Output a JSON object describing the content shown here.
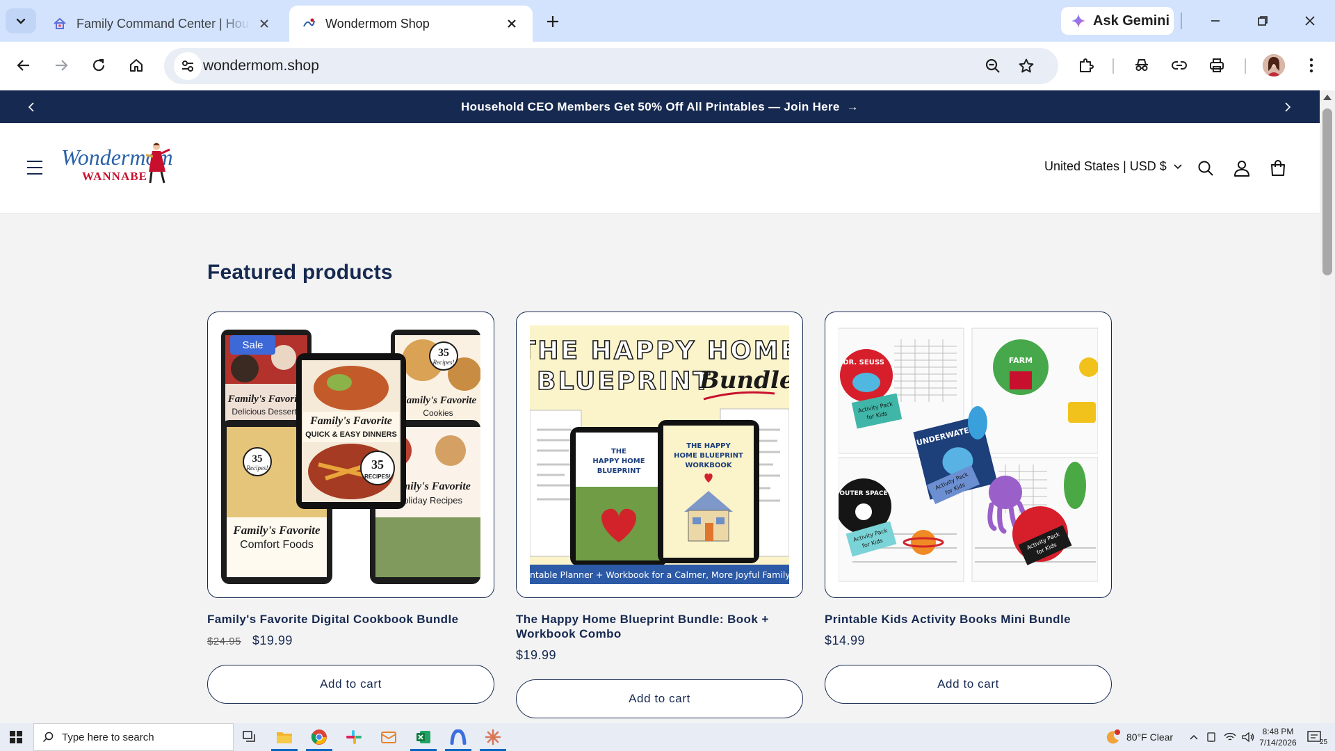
{
  "browser": {
    "tabs": [
      {
        "title": "Family Command Center | Hous",
        "active": false
      },
      {
        "title": "Wondermom Shop",
        "active": true
      }
    ],
    "gemini_label": "Ask Gemini",
    "url": "wondermom.shop"
  },
  "announcement": {
    "text": "Household CEO Members Get 50% Off All Printables — Join Here",
    "arrow": "→"
  },
  "header": {
    "logo_text": "Wondermom",
    "logo_subtext": "WANNABE",
    "locale": "United States | USD $"
  },
  "section_title": "Featured products",
  "products": [
    {
      "title": "Family's Favorite Digital Cookbook Bundle",
      "badge": "Sale",
      "price_old": "$24.95",
      "price": "$19.99",
      "button": "Add to cart",
      "art": {
        "t1": "Family's Favorite",
        "t1b": "Delicious Desserts",
        "t2": "Family's Favorite",
        "t2b": "QUICK & EASY DINNERS",
        "t3": "Family's Favorite",
        "t3b": "Cookies",
        "t4": "Family's Favorite",
        "t4b": "Comfort Foods",
        "t5": "Family's Favorite",
        "t5b": "Holiday Recipes",
        "seal_a": "35",
        "seal_b": "Recipes!",
        "seal_c": "RECIPES!"
      }
    },
    {
      "title": "The Happy Home Blueprint Bundle: Book + Workbook Combo",
      "price": "$19.99",
      "button": "Add to cart",
      "art": {
        "line1": "THE HAPPY HOME",
        "line2": "BLUEPRINT",
        "script": "Bundle",
        "tab1a": "THE",
        "tab1b": "HAPPY HOME",
        "tab1c": "BLUEPRINT",
        "tab2a": "THE HAPPY",
        "tab2b": "HOME BLUEPRINT",
        "tab2c": "WORKBOOK",
        "strip": "ntable Planner + Workbook for a Calmer, More Joyful Family L"
      }
    },
    {
      "title": "Printable Kids Activity Books Mini Bundle",
      "price": "$14.99",
      "button": "Add to cart",
      "art": {
        "c1": "DR. SEUSS",
        "c2": "FARM",
        "c3": "UNDERWATER",
        "c4": "OUTER SPACE",
        "pack": "Activity Pack",
        "kids": "for Kids"
      }
    }
  ],
  "taskbar": {
    "search_placeholder": "Type here to search",
    "weather": "80°F  Clear",
    "time": "8:48 PM",
    "date": "7/14/2026",
    "notifications": "25"
  },
  "colors": {
    "navy": "#162950",
    "sale_blue": "#3c68d8",
    "tab_strip": "#d3e3fd"
  }
}
